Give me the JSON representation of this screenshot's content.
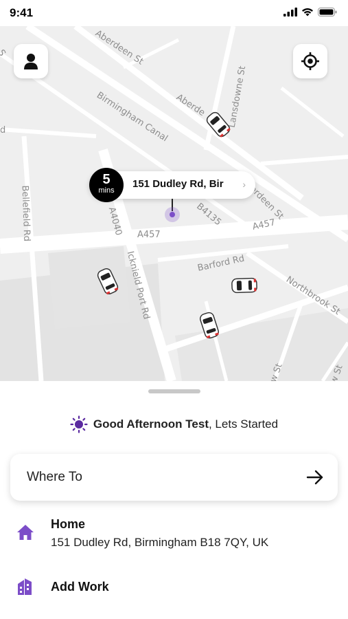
{
  "status_bar": {
    "time": "9:41"
  },
  "map": {
    "streets": {
      "aberdeen_1": "Aberdeen St",
      "aberdeen_2": "Aberde",
      "aberdeen_3": "erdeen St",
      "lansdowne": "Lansdowne St",
      "birmingham_canal": "Birmingham Canal",
      "bellefield": "Bellefield Rd",
      "a4040": "A4040",
      "a457_1": "A457",
      "a457_2": "A457",
      "b4135": "B4135",
      "icknield": "Icknield Port Rd",
      "barford": "Barford Rd",
      "northbrook": "Northbrook St",
      "edge_s": "S",
      "edge_d": "d",
      "bottom_1": "w St",
      "bottom_2": "w St"
    },
    "pickup": {
      "eta_value": "5",
      "eta_unit": "mins",
      "address": "151 Dudley Rd, Bir"
    }
  },
  "sheet": {
    "greeting_name": "Good Afternoon Test",
    "greeting_rest": ", Lets Started",
    "where_to": "Where To",
    "places": [
      {
        "title": "Home",
        "subtitle": "151 Dudley Rd, Birmingham B18 7QY, UK",
        "icon": "home-icon"
      },
      {
        "title": "Add Work",
        "icon": "work-building-icon"
      }
    ]
  },
  "colors": {
    "accent": "#7c4dc8",
    "map_bg": "#efefef"
  }
}
